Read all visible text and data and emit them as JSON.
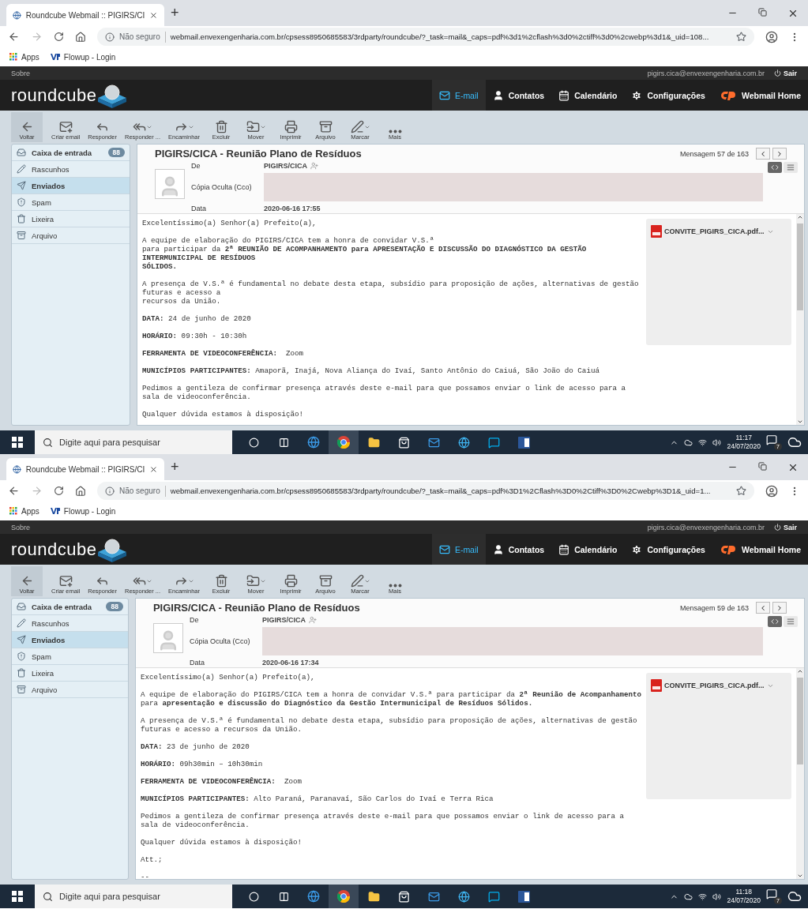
{
  "screens": [
    {
      "browser": {
        "tab_title": "Roundcube Webmail :: PIGIRS/CI",
        "new_tab": "+",
        "security": "Não seguro",
        "url": "webmail.envexengenharia.com.br/cpsess8950685583/3rdparty/roundcube/?_task=mail&_caps=pdf%3d1%2cflash%3d0%2ctiff%3d0%2cwebp%3d1&_uid=108...",
        "bookmarks": [
          "Apps",
          "Flowup - Login"
        ]
      },
      "topbar": {
        "about": "Sobre",
        "user": "pigirs.cica@envexengenharia.com.br",
        "logout": "Sair"
      },
      "logo": "roundcube",
      "nav": [
        {
          "label": "E-mail",
          "selected": true
        },
        {
          "label": "Contatos",
          "selected": false
        },
        {
          "label": "Calendário",
          "selected": false
        },
        {
          "label": "Configurações",
          "selected": false
        },
        {
          "label": "Webmail Home",
          "selected": false
        }
      ],
      "toolbar": [
        {
          "label": "Voltar",
          "has_menu": false
        },
        {
          "label": "Criar email",
          "has_menu": false
        },
        {
          "label": "Responder",
          "has_menu": false
        },
        {
          "label": "Responder ...",
          "has_menu": true
        },
        {
          "label": "Encaminhar",
          "has_menu": true
        },
        {
          "label": "Excluir",
          "has_menu": false
        },
        {
          "label": "Mover",
          "has_menu": true
        },
        {
          "label": "Imprimir",
          "has_menu": false
        },
        {
          "label": "Arquivo",
          "has_menu": false
        },
        {
          "label": "Marcar",
          "has_menu": true
        },
        {
          "label": "Mais",
          "has_menu": false
        }
      ],
      "folders": [
        {
          "label": "Caixa de entrada",
          "count": "88",
          "selected": false
        },
        {
          "label": "Rascunhos",
          "selected": false
        },
        {
          "label": "Enviados",
          "selected": true
        },
        {
          "label": "Spam",
          "selected": false
        },
        {
          "label": "Lixeira",
          "selected": false
        },
        {
          "label": "Arquivo",
          "selected": false
        }
      ],
      "message": {
        "subject": "PIGIRS/CICA - Reunião Plano de Resíduos",
        "position": "Mensagem 57 de 163",
        "fields": [
          {
            "kind": "contact",
            "label": "De",
            "value": "PIGIRS/CICA"
          },
          {
            "kind": "redacted",
            "label": "Cópia Oculta (Cco)"
          },
          {
            "kind": "text",
            "label": "Data",
            "value": "2020-06-16 17:55"
          }
        ],
        "attachment": "CONVITE_PIGIRS_CICA.pdf...",
        "body": [
          "Excelentíssimo(a) Senhor(a) Prefeito(a),",
          "A equipe de elaboração do PIGIRS/CICA tem a honra de convidar V.S.ª\npara participar da **2ª REUNIÃO DE ACOMPANHAMENTO para APRESENTAÇÃO E DISCUSSÃO DO DIAGNÓSTICO DA GESTÃO**\n**INTERMUNICIPAL DE RESÍDUOS**\n**SÓLIDOS.**",
          "A presença de V.S.ª é fundamental no debate desta etapa, subsídio para proposição de ações, alternativas de gestão\nfuturas e acesso a\nrecursos da União.",
          "**DATA:** 24 de junho de 2020",
          "**HORÁRIO:** 09:30h - 10:30h",
          "**FERRAMENTA DE VIDEOCONFERÊNCIA:**  Zoom",
          "**MUNICÍPIOS PARTICIPANTES:** Amaporã, Inajá, Nova Aliança do Ivaí, Santo Antônio do Caiuá, São João do Caiuá",
          "Pedimos a gentileza de confirmar presença através deste e-mail para que possamos enviar o link de acesso para a\nsala de videoconferência.",
          "Qualquer dúvida estamos à disposição!"
        ]
      },
      "taskbar": {
        "search_placeholder": "Digite aqui para pesquisar",
        "time": "11:17",
        "date": "24/07/2020",
        "notifications": "7"
      }
    },
    {
      "browser": {
        "tab_title": "Roundcube Webmail :: PIGIRS/CI",
        "new_tab": "+",
        "security": "Não seguro",
        "url": "webmail.envexengenharia.com.br/cpsess8950685583/3rdparty/roundcube/?_task=mail&_caps=pdf%3D1%2Cflash%3D0%2Ctiff%3D0%2Cwebp%3D1&_uid=1...",
        "bookmarks": [
          "Apps",
          "Flowup - Login"
        ]
      },
      "topbar": {
        "about": "Sobre",
        "user": "pigirs.cica@envexengenharia.com.br",
        "logout": "Sair"
      },
      "logo": "roundcube",
      "nav": [
        {
          "label": "E-mail",
          "selected": true
        },
        {
          "label": "Contatos",
          "selected": false
        },
        {
          "label": "Calendário",
          "selected": false
        },
        {
          "label": "Configurações",
          "selected": false
        },
        {
          "label": "Webmail Home",
          "selected": false
        }
      ],
      "toolbar": [
        {
          "label": "Voltar",
          "has_menu": false
        },
        {
          "label": "Criar email",
          "has_menu": false
        },
        {
          "label": "Responder",
          "has_menu": false
        },
        {
          "label": "Responder ...",
          "has_menu": true
        },
        {
          "label": "Encaminhar",
          "has_menu": true
        },
        {
          "label": "Excluir",
          "has_menu": false
        },
        {
          "label": "Mover",
          "has_menu": true
        },
        {
          "label": "Imprimir",
          "has_menu": false
        },
        {
          "label": "Arquivo",
          "has_menu": false
        },
        {
          "label": "Marcar",
          "has_menu": true
        },
        {
          "label": "Mais",
          "has_menu": false
        }
      ],
      "folders": [
        {
          "label": "Caixa de entrada",
          "count": "88",
          "selected": false
        },
        {
          "label": "Rascunhos",
          "selected": false
        },
        {
          "label": "Enviados",
          "selected": true
        },
        {
          "label": "Spam",
          "selected": false
        },
        {
          "label": "Lixeira",
          "selected": false
        },
        {
          "label": "Arquivo",
          "selected": false
        }
      ],
      "message": {
        "subject": "PIGIRS/CICA - Reunião Plano de Resíduos",
        "position": "Mensagem 59 de 163",
        "fields": [
          {
            "kind": "contact",
            "label": "De",
            "value": "PIGIRS/CICA"
          },
          {
            "kind": "redacted",
            "label": "Cópia Oculta (Cco)"
          },
          {
            "kind": "text",
            "label": "Data",
            "value": "2020-06-16 17:34"
          }
        ],
        "attachment": "CONVITE_PIGIRS_CICA.pdf...",
        "body": [
          "Excelentíssimo(a) Senhor(a) Prefeito(a),",
          "A equipe de elaboração do PIGIRS/CICA tem a honra de convidar V.S.ª para participar da **2ª Reunião de Acompanhamento**\npara **apresentação e discussão do Diagnóstico da Gestão Intermunicipal de Resíduos Sólidos.**",
          "A presença de V.S.ª é fundamental no debate desta etapa, subsídio para proposição de ações, alternativas de gestão\nfuturas e acesso a recursos da União.",
          "**DATA:** 23 de junho de 2020",
          "**HORÁRIO:** 09h30min – 10h30min",
          "**FERRAMENTA DE VIDEOCONFERÊNCIA:**  Zoom",
          "**MUNICÍPIOS PARTICIPANTES:** Alto Paraná, Paranavaí, São Carlos do Ivaí e Terra Rica",
          "Pedimos a gentileza de confirmar presença através deste e-mail para que possamos enviar o link de acesso para a\nsala de videoconferência.",
          "Qualquer dúvida estamos à disposição!",
          "Att.;",
          "--"
        ]
      },
      "taskbar": {
        "search_placeholder": "Digite aqui para pesquisar",
        "time": "11:18",
        "date": "24/07/2020",
        "notifications": "7"
      }
    }
  ]
}
